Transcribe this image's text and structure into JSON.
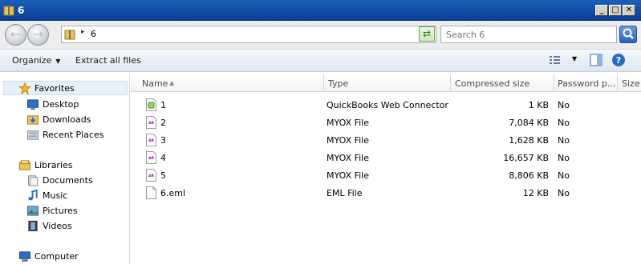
{
  "window": {
    "title": "6"
  },
  "title_buttons": [
    "_",
    "□",
    "✕"
  ],
  "address": {
    "path": "6",
    "separator": "▸"
  },
  "search": {
    "placeholder": "Search 6"
  },
  "commands": {
    "organize": "Organize",
    "extract_all": "Extract all files"
  },
  "nav": {
    "favorites": "Favorites",
    "desktop": "Desktop",
    "downloads": "Downloads",
    "recent_places": "Recent Places",
    "libraries": "Libraries",
    "documents": "Documents",
    "music": "Music",
    "pictures": "Pictures",
    "videos": "Videos",
    "computer": "Computer"
  },
  "columns": {
    "name": "Name",
    "type": "Type",
    "compressed_size": "Compressed size",
    "password": "Password p...",
    "size": "Size"
  },
  "files": [
    {
      "name": "1",
      "type": "QuickBooks Web Connector ...",
      "compressed": "1 KB",
      "password": "No",
      "icon": "qwc-file-icon"
    },
    {
      "name": "2",
      "type": "MYOX File",
      "compressed": "7,084 KB",
      "password": "No",
      "icon": "myox-file-icon"
    },
    {
      "name": "3",
      "type": "MYOX File",
      "compressed": "1,628 KB",
      "password": "No",
      "icon": "myox-file-icon"
    },
    {
      "name": "4",
      "type": "MYOX File",
      "compressed": "16,657 KB",
      "password": "No",
      "icon": "myox-file-icon"
    },
    {
      "name": "5",
      "type": "MYOX File",
      "compressed": "8,806 KB",
      "password": "No",
      "icon": "myox-file-icon"
    },
    {
      "name": "6.eml",
      "type": "EML File",
      "compressed": "12 KB",
      "password": "No",
      "icon": "eml-file-icon"
    }
  ],
  "file_icon_text": "AR"
}
